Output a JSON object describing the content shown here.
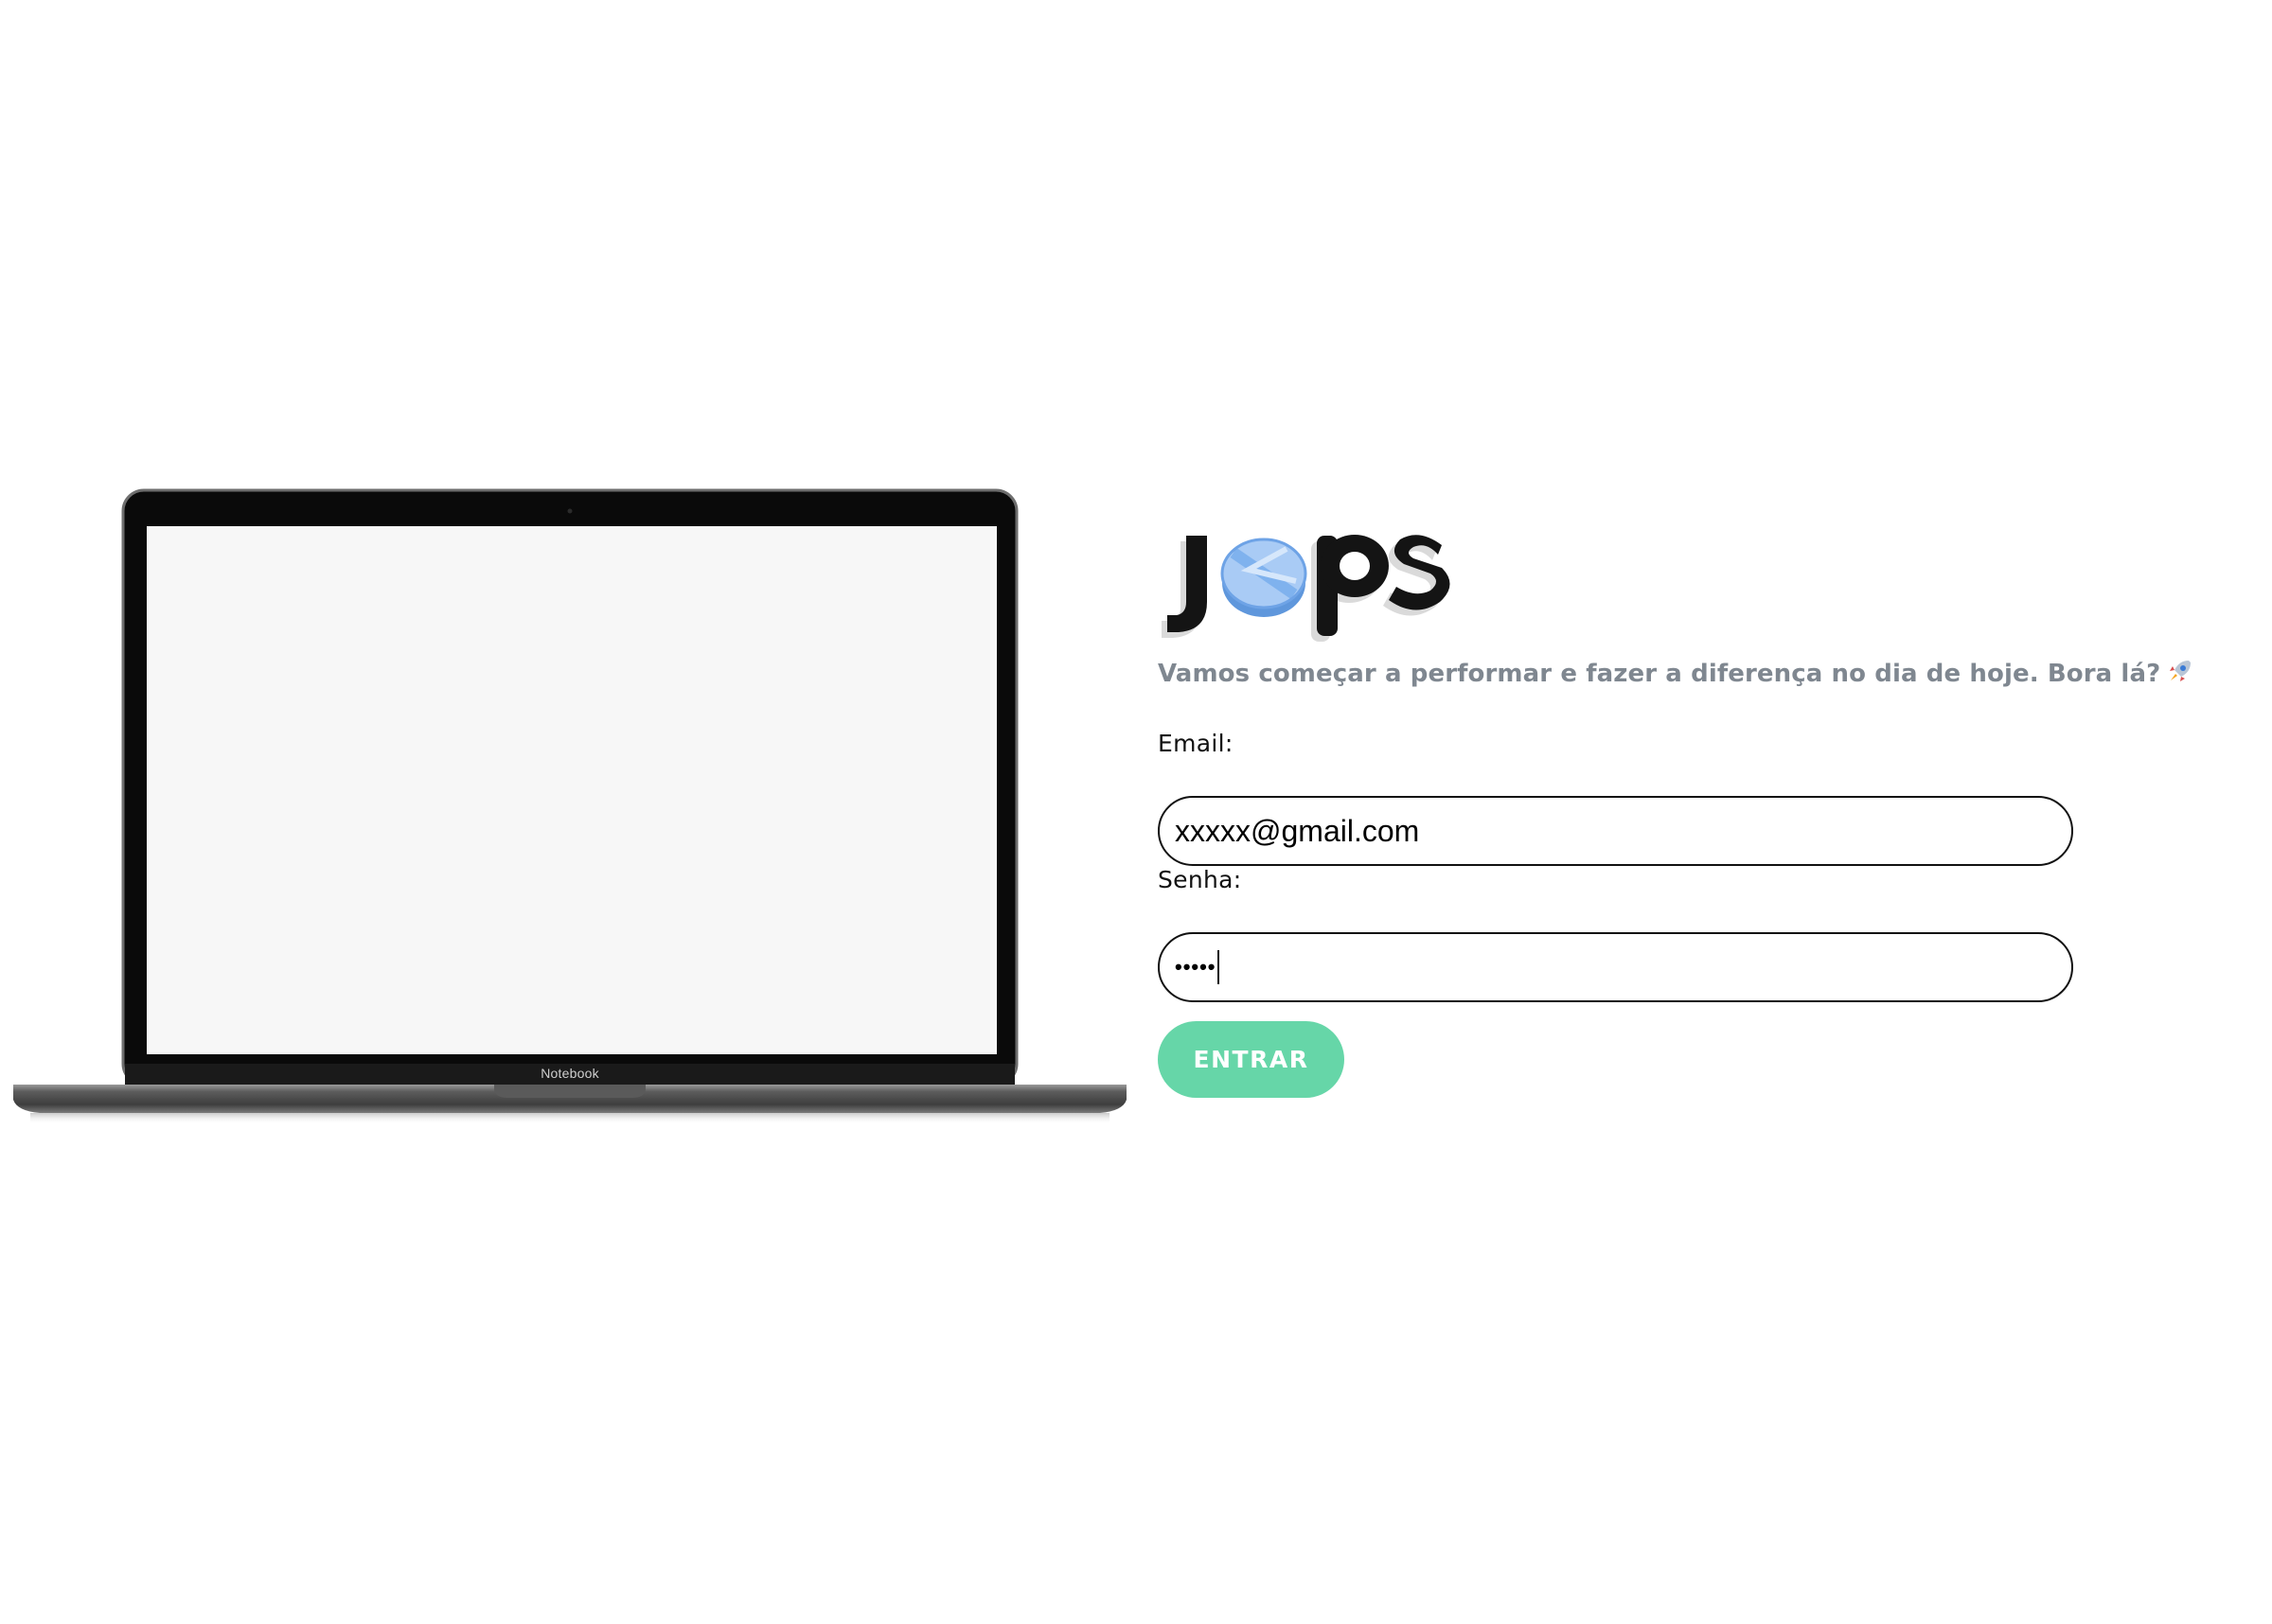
{
  "device": {
    "brand_label": "Notebook"
  },
  "logo": {
    "text": "jops",
    "accent_color": "#7fb2ee"
  },
  "login": {
    "tagline": "Vamos começar a performar e fazer a diferença no dia de hoje. Bora lá?",
    "tagline_emoji": "rocket-icon",
    "email_label": "Email:",
    "email_value": "xxxxx@gmail.com",
    "password_label": "Senha:",
    "password_value": "•••••",
    "submit_label": "ENTRAR"
  },
  "colors": {
    "button": "#66d6a8",
    "tagline": "#7f8790",
    "border": "#111111"
  }
}
